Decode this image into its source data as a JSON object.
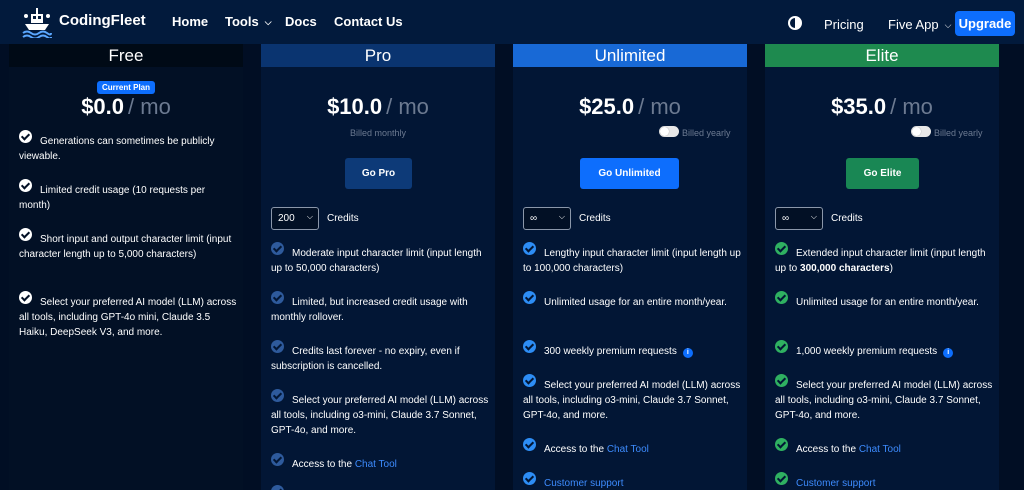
{
  "nav": {
    "brand": "CodingFleet",
    "home": "Home",
    "tools": "Tools",
    "docs": "Docs",
    "contact": "Contact Us",
    "pricing": "Pricing",
    "app": "Five App",
    "upgrade": "Upgrade"
  },
  "plans": {
    "free": {
      "name": "Free",
      "badge": "Current Plan",
      "price": "$0.0",
      "per": "/ mo",
      "features": [
        "Generations can sometimes be publicly viewable.",
        "Limited credit usage (10 requests per month)",
        "Short input and output character limit (input character length up to 5,000 characters)",
        "Select your preferred AI model (LLM) across all tools, including GPT-4o mini, Claude 3.5 Haiku, DeepSeek V3, and more."
      ]
    },
    "pro": {
      "name": "Pro",
      "price": "$10.0",
      "per": "/ mo",
      "billed": "Billed monthly",
      "cta": "Go Pro",
      "credits_value": "200",
      "credits_label": "Credits",
      "features": [
        "Moderate input character limit (input length up to 50,000 characters)",
        "Limited, but increased credit usage with monthly rollover.",
        "Credits last forever - no expiry, even if subscription is cancelled.",
        "Select your preferred AI model (LLM) across all tools, including o3-mini, Claude 3.7 Sonnet, GPT-4o, and more."
      ],
      "chat_prefix": "Access to the ",
      "chat_link": "Chat Tool"
    },
    "unlimited": {
      "name": "Unlimited",
      "price": "$25.0",
      "per": "/ mo",
      "billed": "Billed yearly",
      "cta": "Go Unlimited",
      "credits_value": "∞",
      "credits_label": "Credits",
      "features": [
        "Lengthy input character limit (input length up to 100,000 characters)",
        "Unlimited usage for an entire month/year.",
        "300 weekly premium requests",
        "Select your preferred AI model (LLM) across all tools, including o3-mini, Claude 3.7 Sonnet, GPT-4o, and more."
      ],
      "chat_prefix": "Access to the ",
      "chat_link": "Chat Tool",
      "support": "Customer support"
    },
    "elite": {
      "name": "Elite",
      "price": "$35.0",
      "per": "/ mo",
      "billed": "Billed yearly",
      "cta": "Go Elite",
      "credits_value": "∞",
      "credits_label": "Credits",
      "feature1_prefix": "Extended input character limit (input length up to ",
      "feature1_bold": "300,000 characters",
      "feature1_suffix": ")",
      "features": [
        "Unlimited usage for an entire month/year.",
        "1,000 weekly premium requests",
        "Select your preferred AI model (LLM) across all tools, including o3-mini, Claude 3.7 Sonnet, GPT-4o, and more."
      ],
      "chat_prefix": "Access to the ",
      "chat_link": "Chat Tool",
      "support": "Customer support"
    }
  },
  "icons": {
    "logo": "ship-logo-icon",
    "theme": "contrast-icon",
    "check": "check-circle-icon",
    "info": "info-icon"
  },
  "colors": {
    "accent": "#0d6efd",
    "pro_header": "#0a3470",
    "unlimited_header": "#1869d6",
    "elite_header": "#1e8a4f"
  }
}
